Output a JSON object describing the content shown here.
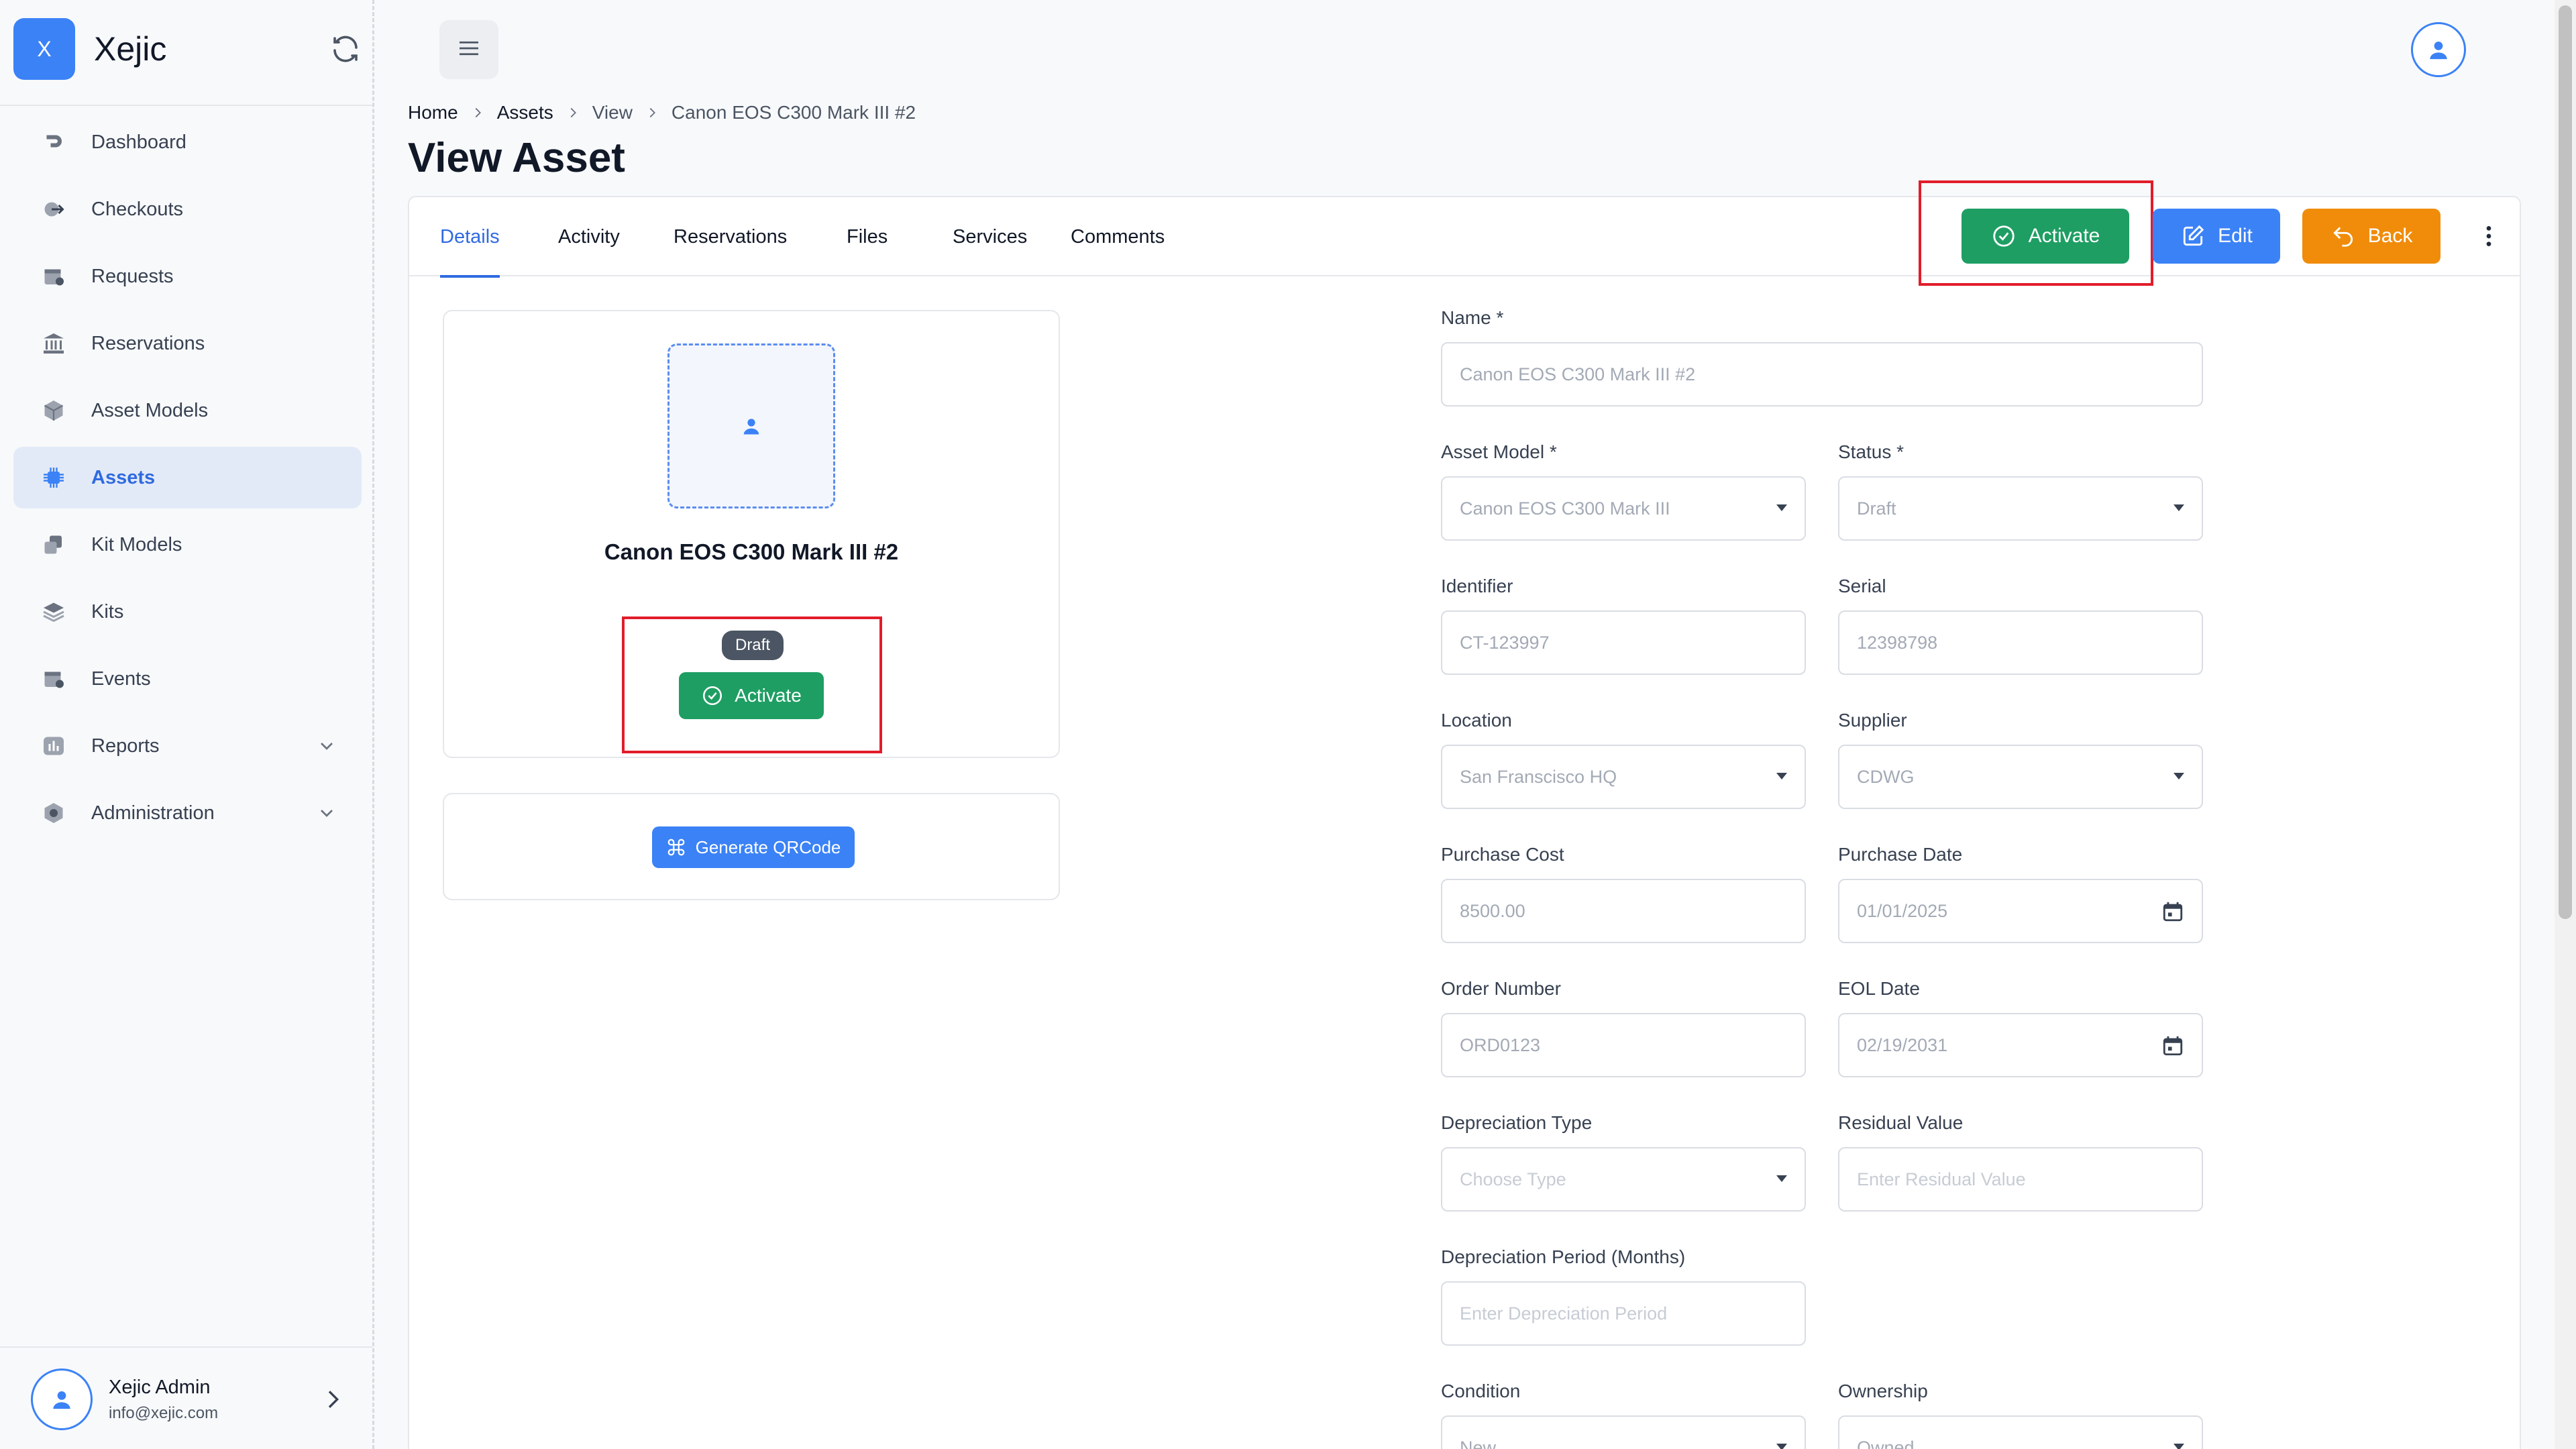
{
  "brand": {
    "logo_letter": "X",
    "name": "Xejic",
    "refresh_icon": "refresh-icon"
  },
  "sidebar": {
    "items": [
      {
        "label": "Dashboard",
        "icon": "dashboard-icon"
      },
      {
        "label": "Checkouts",
        "icon": "checkout-icon"
      },
      {
        "label": "Requests",
        "icon": "calendar-request-icon"
      },
      {
        "label": "Reservations",
        "icon": "bank-icon"
      },
      {
        "label": "Asset Models",
        "icon": "cube-icon"
      },
      {
        "label": "Assets",
        "icon": "chip-icon",
        "active": true
      },
      {
        "label": "Kit Models",
        "icon": "kit-model-icon"
      },
      {
        "label": "Kits",
        "icon": "layers-icon"
      },
      {
        "label": "Events",
        "icon": "calendar-event-icon"
      },
      {
        "label": "Reports",
        "icon": "report-icon",
        "expandable": true
      },
      {
        "label": "Administration",
        "icon": "settings-icon",
        "expandable": true
      }
    ]
  },
  "user": {
    "name": "Xejic Admin",
    "email": "info@xejic.com"
  },
  "breadcrumb": {
    "items": [
      "Home",
      "Assets",
      "View",
      "Canon EOS C300 Mark III #2"
    ]
  },
  "page": {
    "title": "View Asset"
  },
  "tabs": [
    "Details",
    "Activity",
    "Reservations",
    "Files",
    "Services",
    "Comments"
  ],
  "actions": {
    "activate": "Activate",
    "edit": "Edit",
    "back": "Back"
  },
  "asset": {
    "name": "Canon EOS C300 Mark III #2",
    "status_badge": "Draft",
    "activate_label": "Activate",
    "qr_label": "Generate QRCode"
  },
  "form": {
    "name": {
      "label": "Name *",
      "value": "Canon EOS C300 Mark III  #2"
    },
    "asset_model": {
      "label": "Asset Model *",
      "value": "Canon EOS C300 Mark III"
    },
    "status": {
      "label": "Status *",
      "value": "Draft"
    },
    "identifier": {
      "label": "Identifier",
      "value": "CT-123997"
    },
    "serial": {
      "label": "Serial",
      "value": "12398798"
    },
    "location": {
      "label": "Location",
      "value": "San Franscisco HQ"
    },
    "supplier": {
      "label": "Supplier",
      "value": "CDWG"
    },
    "purchase_cost": {
      "label": "Purchase Cost",
      "value": "8500.00"
    },
    "purchase_date": {
      "label": "Purchase Date",
      "value": "01/01/2025"
    },
    "order_number": {
      "label": "Order Number",
      "value": "ORD0123"
    },
    "eol_date": {
      "label": "EOL Date",
      "value": "02/19/2031"
    },
    "depreciation_type": {
      "label": "Depreciation Type",
      "placeholder": "Choose Type"
    },
    "residual_value": {
      "label": "Residual Value",
      "placeholder": "Enter Residual Value"
    },
    "depreciation_period": {
      "label": "Depreciation Period (Months)",
      "placeholder": "Enter Depreciation Period"
    },
    "condition": {
      "label": "Condition",
      "value": "New"
    },
    "ownership": {
      "label": "Ownership",
      "value": "Owned"
    }
  },
  "colors": {
    "primary": "#3b82f6",
    "success": "#1e9e63",
    "warning": "#f08c0a",
    "highlight": "#e11d2a"
  }
}
